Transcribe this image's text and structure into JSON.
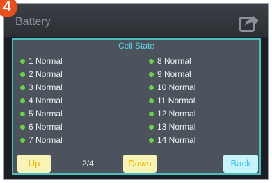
{
  "step_badge": "4",
  "header": {
    "title": "Battery",
    "share_icon": "share-arrow-icon"
  },
  "panel": {
    "title": "Cell State",
    "left_cells": [
      {
        "label": "1 Normal"
      },
      {
        "label": "2 Normal"
      },
      {
        "label": "3 Normal"
      },
      {
        "label": "4 Normal"
      },
      {
        "label": "5 Normal"
      },
      {
        "label": "6 Normal"
      },
      {
        "label": "7 Normal"
      }
    ],
    "right_cells": [
      {
        "label": "8 Normal"
      },
      {
        "label": "9 Normal"
      },
      {
        "label": "10 Normal"
      },
      {
        "label": "11 Normal"
      },
      {
        "label": "12 Normal"
      },
      {
        "label": "13 Normal"
      },
      {
        "label": "14 Normal"
      }
    ],
    "status_dot_color": "#6bd14a"
  },
  "footer": {
    "up_label": "Up",
    "page_indicator": "2/4",
    "down_label": "Down",
    "back_label": "Back"
  },
  "colors": {
    "accent_title": "#5fd4e5",
    "badge": "#e8501f",
    "panel_border": "#49c0bf"
  }
}
